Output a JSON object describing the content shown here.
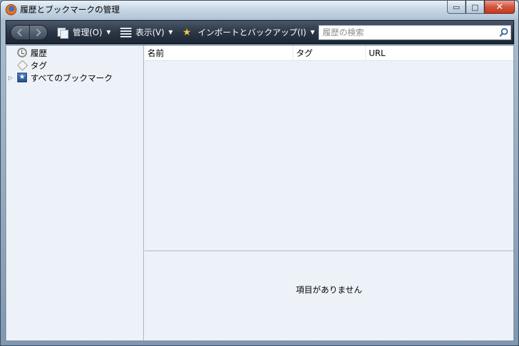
{
  "window": {
    "title": "履歴とブックマークの管理",
    "controls": {
      "minimize": "▭",
      "maximize": "□",
      "close": "✕"
    }
  },
  "toolbar": {
    "back_icon": "chevron-left-icon",
    "forward_icon": "chevron-right-icon",
    "organize_label": "管理(O)",
    "view_label": "表示(V)",
    "import_label": "インポートとバックアップ(I)",
    "search_placeholder": "履歴の検索",
    "search_value": ""
  },
  "sidebar": {
    "items": [
      {
        "label": "履歴",
        "icon": "clock-icon"
      },
      {
        "label": "タグ",
        "icon": "tag-icon"
      },
      {
        "label": "すべてのブックマーク",
        "icon": "bookmarks-icon",
        "expandable": true
      }
    ]
  },
  "table": {
    "columns": [
      "名前",
      "タグ",
      "URL"
    ],
    "rows": []
  },
  "details": {
    "empty_message": "項目がありません"
  },
  "colors": {
    "toolbar_dark": "#2b3747",
    "content_bg": "#edf1f8",
    "close_button": "#d5543a"
  }
}
